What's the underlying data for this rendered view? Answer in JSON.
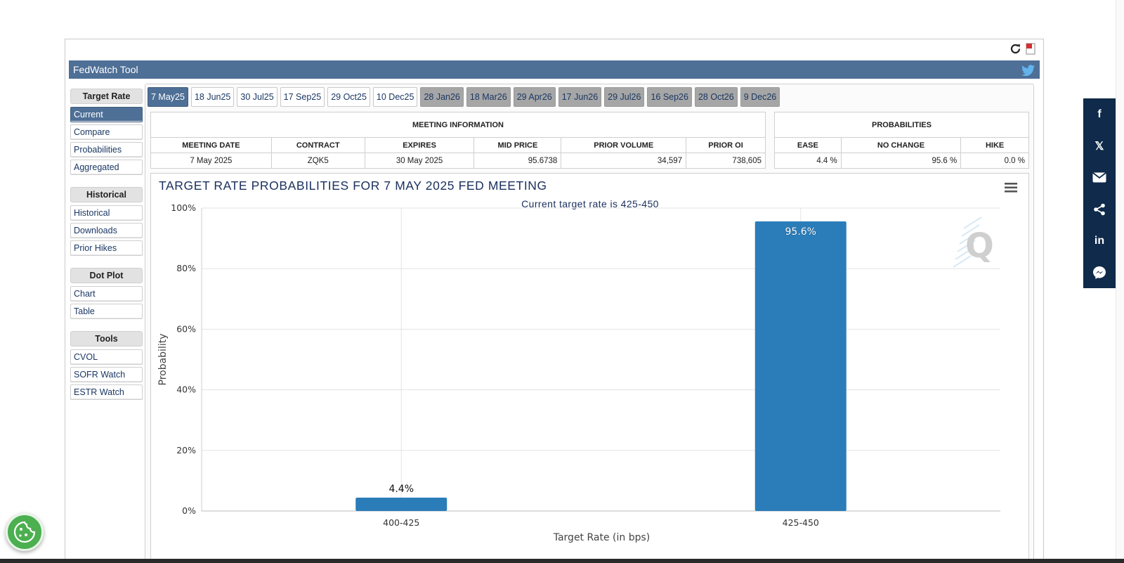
{
  "app": {
    "title": "FedWatch Tool"
  },
  "sidebar": {
    "sections": [
      {
        "heading": "Target Rate",
        "items": [
          "Current",
          "Compare",
          "Probabilities",
          "Aggregated"
        ]
      },
      {
        "heading": "Historical",
        "items": [
          "Historical",
          "Downloads",
          "Prior Hikes"
        ]
      },
      {
        "heading": "Dot Plot",
        "items": [
          "Chart",
          "Table"
        ]
      },
      {
        "heading": "Tools",
        "items": [
          "CVOL",
          "SOFR Watch",
          "ESTR Watch"
        ]
      }
    ],
    "active_item": "Current"
  },
  "tabs": [
    {
      "label": "7 May25",
      "state": "active"
    },
    {
      "label": "18 Jun25",
      "state": "normal"
    },
    {
      "label": "30 Jul25",
      "state": "normal"
    },
    {
      "label": "17 Sep25",
      "state": "normal"
    },
    {
      "label": "29 Oct25",
      "state": "normal"
    },
    {
      "label": "10 Dec25",
      "state": "normal"
    },
    {
      "label": "28 Jan26",
      "state": "inactive"
    },
    {
      "label": "18 Mar26",
      "state": "inactive"
    },
    {
      "label": "29 Apr26",
      "state": "inactive"
    },
    {
      "label": "17 Jun26",
      "state": "inactive"
    },
    {
      "label": "29 Jul26",
      "state": "inactive"
    },
    {
      "label": "16 Sep26",
      "state": "inactive"
    },
    {
      "label": "28 Oct26",
      "state": "inactive"
    },
    {
      "label": "9 Dec26",
      "state": "inactive"
    }
  ],
  "meeting_info": {
    "title": "MEETING INFORMATION",
    "headers": [
      "MEETING DATE",
      "CONTRACT",
      "EXPIRES",
      "MID PRICE",
      "PRIOR VOLUME",
      "PRIOR OI"
    ],
    "row": [
      "7 May 2025",
      "ZQK5",
      "30 May 2025",
      "95.6738",
      "34,597",
      "738,605"
    ]
  },
  "probabilities": {
    "title": "PROBABILITIES",
    "headers": [
      "EASE",
      "NO CHANGE",
      "HIKE"
    ],
    "row": [
      "4.4 %",
      "95.6 %",
      "0.0 %"
    ]
  },
  "chart": {
    "title": "TARGET RATE PROBABILITIES FOR 7 MAY 2025 FED MEETING",
    "subtitle": "Current target rate is 425-450"
  },
  "chart_data": {
    "type": "bar",
    "title": "TARGET RATE PROBABILITIES FOR 7 MAY 2025 FED MEETING",
    "subtitle": "Current target rate is 425-450",
    "categories": [
      "400-425",
      "425-450"
    ],
    "values": [
      4.4,
      95.6
    ],
    "data_labels": [
      "4.4%",
      "95.6%"
    ],
    "xlabel": "Target Rate (in bps)",
    "ylabel": "Probability",
    "ylim": [
      0,
      100
    ],
    "yticks": [
      "0%",
      "20%",
      "40%",
      "60%",
      "80%",
      "100%"
    ],
    "grid": true,
    "bar_color": "#2a7db8"
  },
  "share": {
    "buttons": [
      "f",
      "𝕏",
      "✉",
      "share",
      "in",
      "messenger"
    ]
  },
  "colors": {
    "header": "#4e6f96",
    "share_bar": "#0f2a4a",
    "bar": "#2a7db8"
  }
}
